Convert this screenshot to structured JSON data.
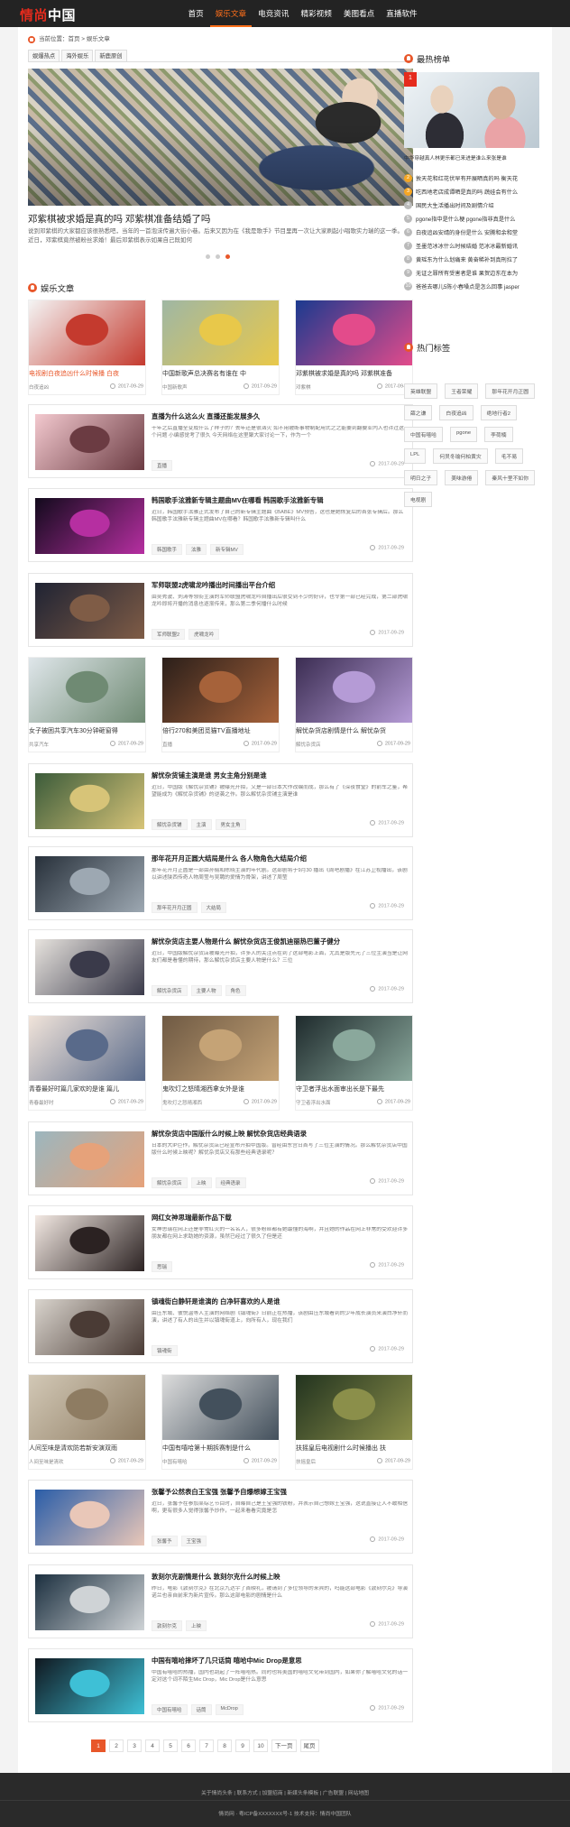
{
  "header": {
    "logo_red": "情尚",
    "logo_white": "中国",
    "nav": [
      "首页",
      "娱乐文章",
      "电竞资讯",
      "精彩视频",
      "美图看点",
      "直播软件"
    ]
  },
  "breadcrumb": "当前位置：首页 > 娱乐文章",
  "tabs": [
    "娱爆热点",
    "海外娱乐",
    "新鹿原创"
  ],
  "slider": {
    "title": "邓紫棋被求婚是真的吗 邓紫棋准备结婚了吗",
    "desc": "说到邓紫棋的大家都应该很熟悉吧，当年的一首泡沫传遍大街小巷。后来又因为在《我是歌手》节目里再一次让大家刷起小唱歌实力瑞的这一季。近日，邓紫棋竟然被粉丝求婚！最后邓紫棋表示如果自己既如何"
  },
  "section_title": "娱乐文章",
  "trios": [
    {
      "items": [
        {
          "title": "电视剧白夜追凶什么时候播 白夜",
          "meta": "白夜追凶",
          "date": "2017-09-29",
          "color1": "#f4f4f4",
          "color2": "#c43a2e"
        },
        {
          "title": "中国新歌声总决赛名有谁在 中",
          "meta": "中国新歌声",
          "date": "2017-09-29",
          "color1": "#9fb7a4",
          "color2": "#e8c84a"
        },
        {
          "title": "邓紫棋被求婚是真的吗 邓紫棋准备",
          "meta": "邓紫棋",
          "date": "2017-09-29",
          "color1": "#1b3a8f",
          "color2": "#e34b8b"
        }
      ]
    },
    {
      "items": [
        {
          "title": "女子被困共享汽车30分钟砸窗得",
          "meta": "共享汽车",
          "date": "2017-09-29",
          "color1": "#dfe6ea",
          "color2": "#6f8a73"
        },
        {
          "title": "倍行270和美团觅猫TV直播地址",
          "meta": "直播",
          "date": "2017-09-29",
          "color1": "#2b1f1a",
          "color2": "#a6623a"
        },
        {
          "title": "解忧杂货店剧情是什么 解忧杂货",
          "meta": "解忧杂货店",
          "date": "2017-09-29",
          "color1": "#3b2d52",
          "color2": "#b59bd6"
        }
      ]
    },
    {
      "items": [
        {
          "title": "青春最好时篇几家欢的是谁 篇儿",
          "meta": "青春最好时",
          "date": "2017-09-29",
          "color1": "#f1e4da",
          "color2": "#596a8a"
        },
        {
          "title": "鬼吹灯之怒晴湘西拿女外是谁",
          "meta": "鬼吹灯之怒晴湘西",
          "date": "2017-09-29",
          "color1": "#6f5a44",
          "color2": "#c5a376"
        },
        {
          "title": "守卫者浮出水面审出长是下最先",
          "meta": "守卫者浮出水面",
          "date": "2017-09-29",
          "color1": "#1e2a2c",
          "color2": "#8aa89c"
        }
      ]
    },
    {
      "items": [
        {
          "title": "人间至味是清欢防若新安演双雨",
          "meta": "人间至味是清欢",
          "date": "2017-09-29",
          "color1": "#d2c8b6",
          "color2": "#8e7c62"
        },
        {
          "title": "中国有嘻哈第十期拆赛制是什么",
          "meta": "中国有嘻哈",
          "date": "2017-09-29",
          "color1": "#dcdcdc",
          "color2": "#43505c"
        },
        {
          "title": "扶摇皇后电视剧什么时候播出 扶",
          "meta": "扶摇皇后",
          "date": "2017-09-29",
          "color1": "#22331f",
          "color2": "#8b8f4a"
        }
      ]
    }
  ],
  "rows": [
    {
      "title": "直播为什么这么火 直播还能发展多久",
      "summary": "十年之后直播全变成什么了样子的？去年还是很汹火 如不用被断事物制配用式之之能要到翻要业内人也许过这个问题 小编感觉考了很久 今天网络在这里聚大家讨论一下，作为一个",
      "tags": [
        "直播"
      ],
      "date": "2017-09-29",
      "color1": "#f3c9cf",
      "color2": "#6b3b42"
    },
    {
      "title": "韩国歌手泫雅新专辑主题曲MV在哪看 韩国歌手泫雅新专辑",
      "summary": "近日，韩国歌手泫雅正式发布了自己的新专辑主题曲《BABE》MV预告，这也是她恢复后的首张专辑后。那么韩国歌手泫雅新专辑主题曲MV在哪看？韩国歌手泫雅新专辑叫什么",
      "tags": [
        "韩国歌手",
        "泫雅",
        "新专辑MV"
      ],
      "date": "2017-09-29",
      "color1": "#120a1c",
      "color2": "#b62fa1"
    },
    {
      "title": "军师联盟2虎啸龙吟播出时间播出平台介绍",
      "summary": "由吴秀波、刘涛等领衔主演的军师联盟虎啸龙吟自播出后很受到不少的好评，也令第一部已经完成，第二部虎啸龙吟即将开播的消息也逐渐传来，那么第二季何播什么时候",
      "tags": [
        "军师联盟2",
        "虎啸龙吟"
      ],
      "date": "2017-09-29",
      "color1": "#1f2333",
      "color2": "#7f5c46"
    },
    {
      "title": "解忧杂货铺主演是谁 男女主角分别是谁",
      "summary": "近日，中国版《解忧杂货铺》被曝光开拍，又是一部日本大作改编而成，那么有了《深夜食堂》的前车之鉴，希望能成为《解忧杂货铺》的逆袭之作。那么解忧杂货铺主演是谁",
      "tags": [
        "解忧杂货铺",
        "主演",
        "男女主角"
      ],
      "date": "2017-09-29",
      "color1": "#3b5b3a",
      "color2": "#d7c478"
    },
    {
      "title": "那年花开月正圆大结局是什么 各人物角色大结局介绍",
      "summary": "那年花开月正圆是一部由孙俪和陈晓主演的年代剧。这部剧将于9月30 播出《周吧剧播》在江苏卫视播出，该剧以讲述陕西传奇人物周莹与吴聘的爱情为骨架，讲述了周莹",
      "tags": [
        "那年花开月正圆",
        "大结局"
      ],
      "date": "2017-09-29",
      "color1": "#27303a",
      "color2": "#9da8b2"
    },
    {
      "title": "解忧杂货店主要人物是什么 解忧杂货店王俊凯迪丽热巴董子健分",
      "summary": "近日，中国版解忧杂货店被曝光开拍，许多人的关注点在到了这部电影上面，尤其是版先元了三位主演当是让网友们都是看懂的期待，那么解忧杂货店主要人物是什么？三位",
      "tags": [
        "解忧杂货店",
        "主要人物",
        "角色"
      ],
      "date": "2017-09-29",
      "color1": "#e7e3de",
      "color2": "#3a3a4a"
    },
    {
      "title": "解忧杂货店中国版什么时候上映 解忧杂货店经典语录",
      "summary": "日本的大IP巨作，解忧杂货店已经宣布开拍中国版。曾经由东宫日首写了三位主演的情况。那么解忧杂货店中国版什么时候上映呢？解忧杂货店又有那些经典语录呢？",
      "tags": [
        "解忧杂货店",
        "上映",
        "经典语录"
      ],
      "date": "2017-09-29",
      "color1": "#9cb6be",
      "color2": "#e6a27a"
    },
    {
      "title": "网红女神思瑞最新作品下载",
      "summary": "女神思瑞在网上还是非常红火的一名名人，很多粉丝都有她最懂的海啊，并且她的作品在网上非常的受欢迎许多朋友都在网上求助她的资源，虽然已经过了很久了但是还",
      "tags": [
        "思瑞"
      ],
      "date": "2017-09-29",
      "color1": "#f3e9e3",
      "color2": "#2b2222"
    },
    {
      "title": "镇魂街白静轩是谁演的 白净轩喜欢的人是谁",
      "summary": "由压东城、彼悦温等人主演的网络剧《镇魂街》日前正在热播，该剧由压东城看到的少年成长演员来演白净轩而演，讲述了有人的出生并以镇魂街道上，向所有人，现在我们",
      "tags": [
        "镇魂街"
      ],
      "date": "2017-09-29",
      "color1": "#d9d4cd",
      "color2": "#4a3b35"
    },
    {
      "title": "张馨予公然表白王宝强 张馨予自爆想嫁王宝强",
      "summary": "近日，张馨予在参加某综艺节目时，自曝自己是王宝强的铁粉，并表示自己想嫁王宝强，这说直接让人不敢相信啊，更有很多人觉得张馨予炒作，一起来看看究竟是怎",
      "tags": [
        "张馨予",
        "王宝强"
      ],
      "date": "2017-09-29",
      "color1": "#2a5da8",
      "color2": "#e9c7b8"
    },
    {
      "title": "敦刻尔克剧情是什么 敦刻尔克什么时候上映",
      "summary": "昨日，电影《敦刻尔克》在北京九达宇了首映礼，被请到了多位领导的来宾的，吗能这部电影《敦刻尔克》导演诺兰也亲自前来为新片宣传。那么这部电影的剧情是什么",
      "tags": [
        "敦刻尔克",
        "上映"
      ],
      "date": "2017-09-29",
      "color1": "#1b2f3f",
      "color2": "#cfd3d6"
    },
    {
      "title": "中国有嘻哈摔坏了几只话筒 嘻哈中Mic Drop是意思",
      "summary": "中国有嘻哈的热播，国内也刮起了一阵嘻哈热。同时也将美国的嘻哈文化带到国内，如果你了解嘻哈文化的话一定对这个词不陌生Mic Drop，Mic Drop是什么意思",
      "tags": [
        "中国有嘻哈",
        "话筒",
        "McDrop"
      ],
      "date": "2017-09-29",
      "color1": "#101820",
      "color2": "#3ec0d6"
    }
  ],
  "pagination": [
    "1",
    "2",
    "3",
    "4",
    "5",
    "6",
    "7",
    "8",
    "9",
    "10",
    "下一页",
    "尾页"
  ],
  "sidebar": {
    "hot_title": "最热榜单",
    "hot_badge": "1",
    "hot_caption": "中华穿越真人林更乐都已来进是谁么来张是谁",
    "ranks": [
      {
        "n": "2",
        "text": "敦天花和红花伏早有开展晒真的吗 衡天花"
      },
      {
        "n": "3",
        "text": "吃西地老店成谭晒是真的吗 蔬娃会有什么"
      },
      {
        "n": "4",
        "text": "国民大生活播出时间及剧情介绍"
      },
      {
        "n": "5",
        "text": "pgone指中是什么梗 pgone指非真是什么"
      },
      {
        "n": "6",
        "text": "白夜追凶安靖的身份是什么 安腾和余和堂"
      },
      {
        "n": "7",
        "text": "圣墨范冰冰什么时候结婚 范冰冰最新婚讯"
      },
      {
        "n": "8",
        "text": "黄瑶东为什么划痛来 黄奋稀补到真刑拉了"
      },
      {
        "n": "9",
        "text": "无证之罪所有受害者是谁 果贺边东在本为"
      },
      {
        "n": "10",
        "text": "爸爸去哪儿5陈小春嗓点是怎么回事 jasper"
      }
    ],
    "tags_title": "热门标签",
    "tags": [
      "英雄联盟",
      "王者荣耀",
      "那年花开月正圆",
      "薛之谦",
      "白夜追凶",
      "绝地行者2",
      "中国有嘻哈",
      "pgone",
      "李荷楠",
      "LPL",
      "何炅冬瑜何柏黄灾",
      "毛不易",
      "明日之子",
      "美味游倦",
      "秦风十里不如你",
      "电视剧"
    ]
  },
  "footer": {
    "links": "关于情尚头条 | 联系方式 | 加盟招商 | 新媒头条模板 | 广告联盟 | 网站地图",
    "copyright": "情尚网 · 粤ICP备XXXXXXX号-1 技术支持：情尚中国团队"
  }
}
